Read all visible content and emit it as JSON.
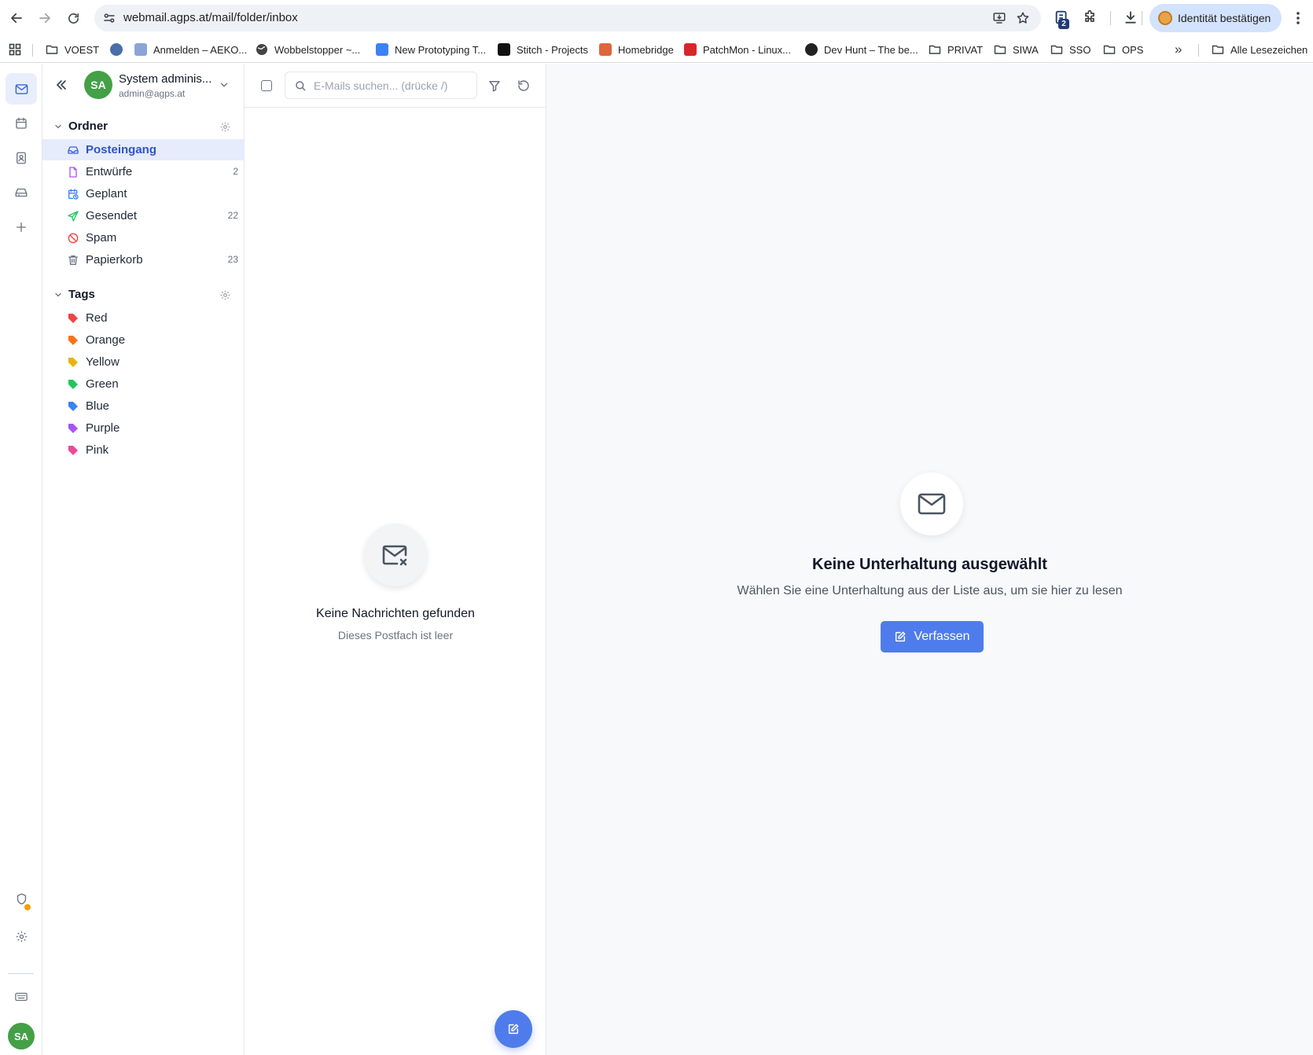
{
  "browser": {
    "url": "webmail.agps.at/mail/folder/inbox",
    "extension_badge": "2",
    "identity_label": "Identität bestätigen",
    "bookmarks": [
      {
        "label": "VOEST",
        "icon": "folder-icon"
      },
      {
        "label": "",
        "icon": "favicon"
      },
      {
        "label": "Anmelden – AEKO...",
        "icon": "favicon"
      },
      {
        "label": "Wobbelstopper ~...",
        "icon": "globe-icon"
      },
      {
        "label": "New Prototyping T...",
        "icon": "favicon"
      },
      {
        "label": "Stitch - Projects",
        "icon": "favicon"
      },
      {
        "label": "Homebridge",
        "icon": "favicon"
      },
      {
        "label": "PatchMon - Linux...",
        "icon": "favicon"
      },
      {
        "label": "Dev Hunt – The be...",
        "icon": "favicon"
      },
      {
        "label": "PRIVAT",
        "icon": "folder-icon"
      },
      {
        "label": "SIWA",
        "icon": "folder-icon"
      },
      {
        "label": "SSO",
        "icon": "folder-icon"
      },
      {
        "label": "OPS",
        "icon": "folder-icon"
      }
    ],
    "more_bookmarks": "»",
    "all_bookmarks": "Alle Lesezeichen"
  },
  "rail": {
    "avatar_initials": "SA"
  },
  "account": {
    "initials": "SA",
    "name": "System adminis...",
    "email": "admin@agps.at"
  },
  "folders_section": {
    "title": "Ordner",
    "items": [
      {
        "label": "Posteingang",
        "count": "",
        "icon": "inbox-icon",
        "active": true
      },
      {
        "label": "Entwürfe",
        "count": "2",
        "icon": "draft-icon"
      },
      {
        "label": "Geplant",
        "count": "",
        "icon": "scheduled-icon"
      },
      {
        "label": "Gesendet",
        "count": "22",
        "icon": "send-icon"
      },
      {
        "label": "Spam",
        "count": "",
        "icon": "spam-icon"
      },
      {
        "label": "Papierkorb",
        "count": "23",
        "icon": "trash-icon"
      }
    ]
  },
  "tags_section": {
    "title": "Tags",
    "items": [
      {
        "label": "Red",
        "color": "#ef4444"
      },
      {
        "label": "Orange",
        "color": "#f97316"
      },
      {
        "label": "Yellow",
        "color": "#eab308"
      },
      {
        "label": "Green",
        "color": "#22c55e"
      },
      {
        "label": "Blue",
        "color": "#3b82f6"
      },
      {
        "label": "Purple",
        "color": "#a855f7"
      },
      {
        "label": "Pink",
        "color": "#ec4899"
      }
    ]
  },
  "list": {
    "search_placeholder": "E-Mails suchen... (drücke /)",
    "empty_title": "Keine Nachrichten gefunden",
    "empty_subtitle": "Dieses Postfach ist leer"
  },
  "reader": {
    "empty_title": "Keine Unterhaltung ausgewählt",
    "empty_subtitle": "Wählen Sie eine Unterhaltung aus der Liste aus, um sie hier zu lesen",
    "compose_label": "Verfassen"
  },
  "colors": {
    "accent": "#4f7cec",
    "active_folder_bg": "#e6ecfb",
    "avatar": "#43a047",
    "notification_dot": "#f59e0b"
  }
}
